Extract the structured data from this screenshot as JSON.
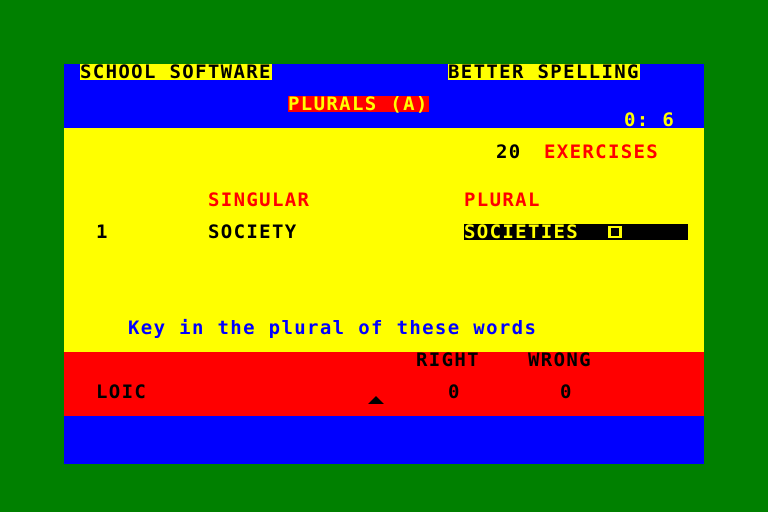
{
  "header": {
    "publisher": "SCHOOL SOFTWARE",
    "program_title": "BETTER SPELLING",
    "lesson_title": "PLURALS (A)",
    "timer": "0: 6"
  },
  "exercise_info": {
    "count": "20",
    "label": "EXERCISES"
  },
  "columns": {
    "singular": "SINGULAR",
    "plural": "PLURAL"
  },
  "current_item": {
    "number": "1",
    "singular_word": "SOCIETY",
    "plural_input_value": "SOCIETIES"
  },
  "instruction": "Key in the plural of these words",
  "score": {
    "right_label": "RIGHT",
    "wrong_label": "WRONG",
    "player_name": "LOIC",
    "right_value": "0",
    "wrong_value": "0"
  },
  "colors": {
    "border": "#008000",
    "header_bg": "#0000ff",
    "main_bg": "#ffff00",
    "score_bg": "#ff0000",
    "accent_red": "#ff0000",
    "instruction_blue": "#0000ff"
  }
}
